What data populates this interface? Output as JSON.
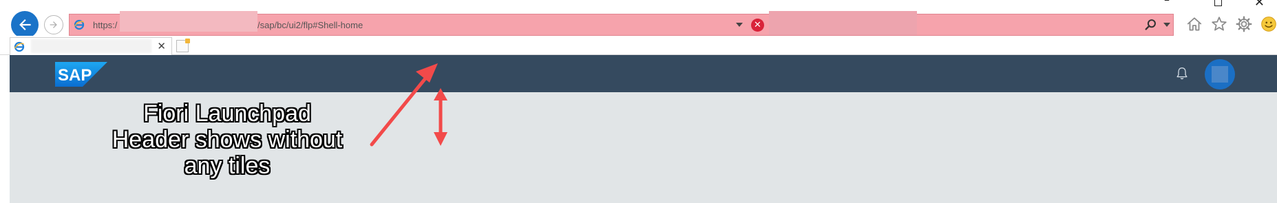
{
  "browser": {
    "window_controls": {
      "minimize": "–",
      "close": "✕"
    },
    "address_bar": {
      "url_prefix": "https:/",
      "url_suffix": "/sap/bc/ui2/flp#Shell-home",
      "cert_error_icon": "✕",
      "background_color": "#f6a3ac"
    },
    "tab": {
      "close_label": "✕"
    },
    "toolbar_icons": [
      "home-icon",
      "favorites-star-icon",
      "settings-gear-icon",
      "feedback-smiley-icon"
    ]
  },
  "shell": {
    "header_color": "#354a5f",
    "logo_text": "SAP",
    "icons": [
      "notifications-bell-icon",
      "user-avatar"
    ],
    "content_background": "#e1e5e7"
  },
  "annotation": {
    "text_line1": "Fiori Launchpad",
    "text_line2": "Header shows without",
    "text_line3": "any tiles",
    "arrow_color": "#f24a4a"
  }
}
